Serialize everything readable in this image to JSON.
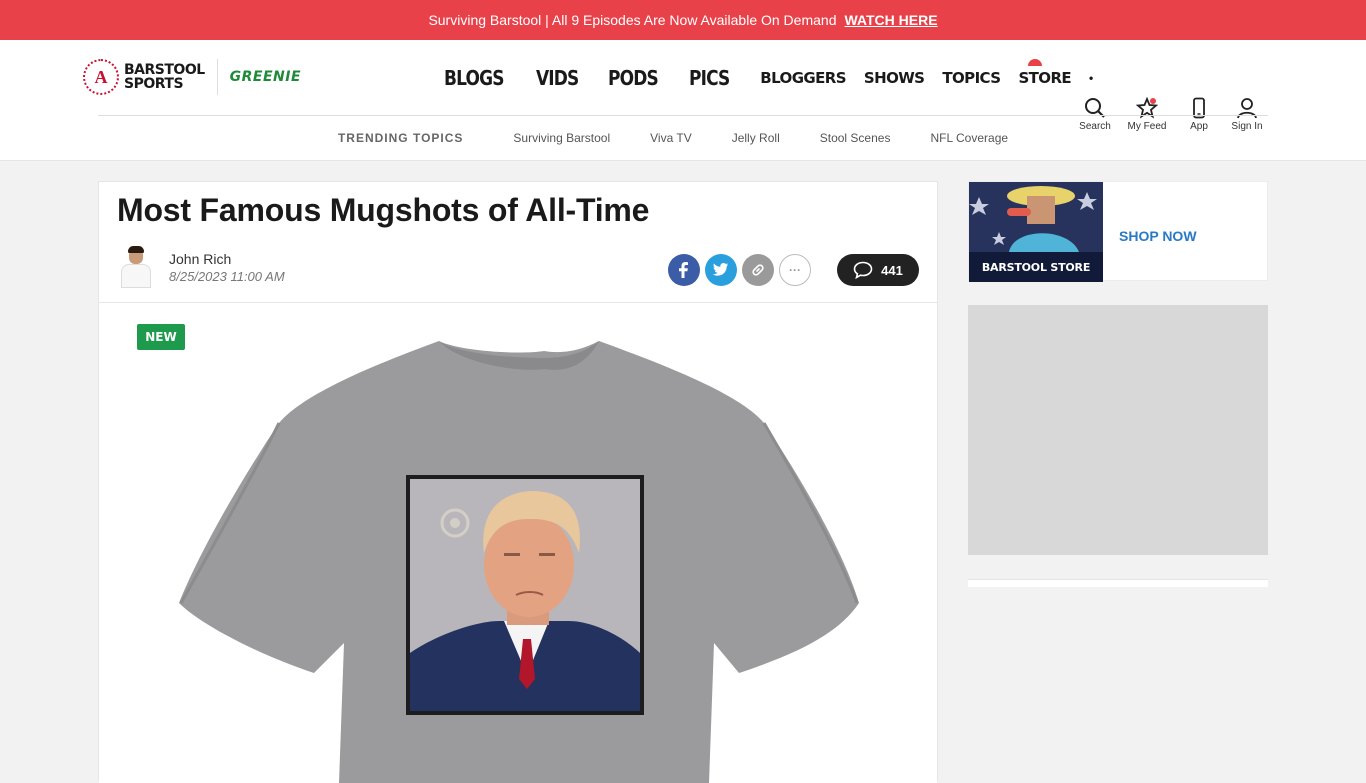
{
  "promo": {
    "text": "Surviving Barstool | All 9 Episodes Are Now Available On Demand",
    "link": "WATCH HERE"
  },
  "brand": {
    "seal": "A",
    "line1": "BARSTOOL",
    "line2": "SPORTS",
    "partner": "GREENIE"
  },
  "nav": {
    "big": [
      "BLOGS",
      "VIDS",
      "PODS",
      "PICS"
    ],
    "small": [
      "BLOGGERS",
      "SHOWS",
      "TOPICS",
      "STORE"
    ],
    "more": "•"
  },
  "utility": {
    "search": "Search",
    "myfeed": "My Feed",
    "app": "App",
    "signin": "Sign In"
  },
  "trending": {
    "label": "TRENDING TOPICS",
    "topics": [
      "Surviving Barstool",
      "Viva TV",
      "Jelly Roll",
      "Stool Scenes",
      "NFL Coverage"
    ]
  },
  "article": {
    "title": "Most Famous Mugshots of All-Time",
    "author": "John Rich",
    "date": "8/25/2023 11:00 AM",
    "comment_count": "441",
    "badge": "NEW"
  },
  "sidebar": {
    "store_label": "BARSTOOL STORE",
    "shop_now": "SHOP NOW"
  },
  "colors": {
    "brand_red": "#e8414a",
    "greenie": "#1e8a3a",
    "facebook": "#3b5ca6",
    "twitter": "#2a9fde"
  }
}
